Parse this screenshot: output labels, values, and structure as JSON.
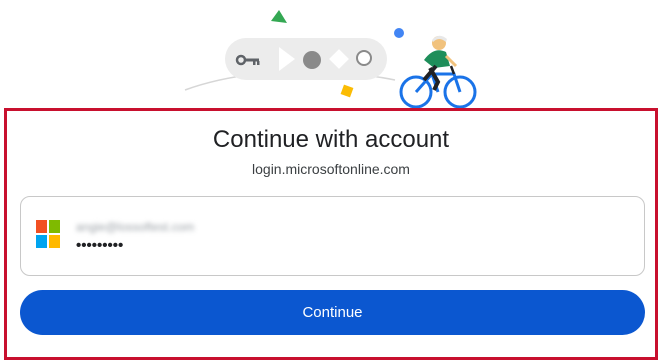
{
  "dialog": {
    "title": "Continue with account",
    "subtitle": "login.microsoftonline.com"
  },
  "account": {
    "email": "angie@lossoftest.com",
    "password_mask": "•••••••••",
    "provider_icon": "microsoft-logo-icon"
  },
  "actions": {
    "continue_label": "Continue"
  },
  "colors": {
    "primary_button": "#0b57d0",
    "highlight_border": "#c8102e",
    "ms_red": "#f25022",
    "ms_green": "#7fba00",
    "ms_blue": "#00a4ef",
    "ms_yellow": "#ffb900"
  },
  "illustration": {
    "icons": [
      "key-icon",
      "play-icon",
      "dot-icon",
      "diamond-icon",
      "ring-icon",
      "cyclist-illustration"
    ]
  }
}
